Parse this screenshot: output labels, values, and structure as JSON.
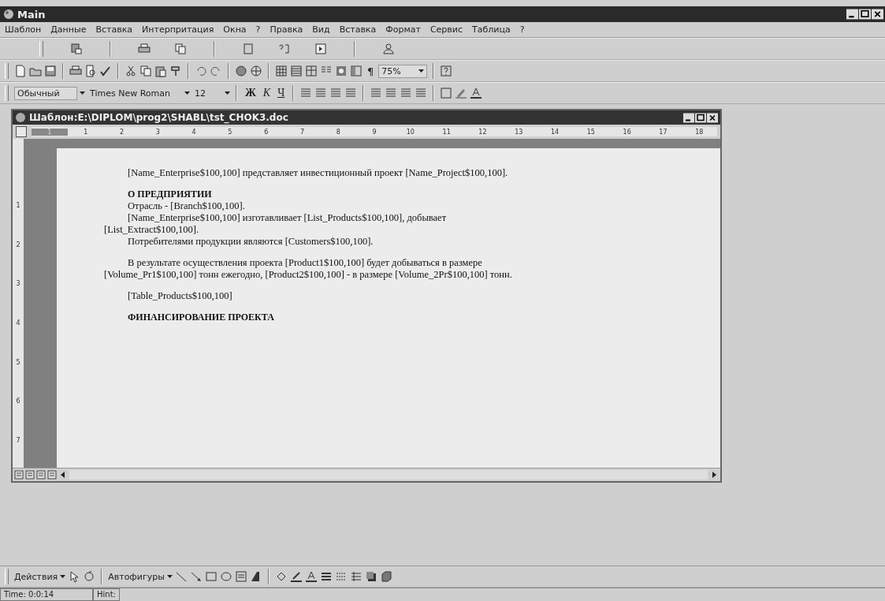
{
  "window": {
    "title": "Main"
  },
  "menu": [
    "Шаблон",
    "Данные",
    "Вставка",
    "Интерпритация",
    "Окна",
    "?",
    "Правка",
    "Вид",
    "Вставка",
    "Формат",
    "Сервис",
    "Таблица",
    "?"
  ],
  "formatting": {
    "style": "Обычный",
    "font": "Times New Roman",
    "size": "12",
    "bold": "Ж",
    "italic": "К",
    "underline": "Ч"
  },
  "standard": {
    "pilcrow": "¶",
    "zoom": "75%"
  },
  "document": {
    "title": "Шаблон:E:\\DIPLOM\\prog2\\SHABL\\tst_CHOK3.doc",
    "ruler": [
      "1",
      "1",
      "2",
      "3",
      "4",
      "5",
      "6",
      "7",
      "8",
      "9",
      "10",
      "11",
      "12",
      "13",
      "14",
      "15",
      "16",
      "17",
      "18"
    ],
    "vruler": [
      "1",
      "2",
      "3",
      "4",
      "5",
      "6",
      "7"
    ],
    "paragraphs": [
      {
        "kind": "para",
        "space_before": false,
        "lines": [
          "[Name_Enterprise$100,100] представляет инвестиционный проект [Name_Project$100,100]."
        ]
      },
      {
        "kind": "heading",
        "space_before": true,
        "lines": [
          "О ПРЕДПРИЯТИИ"
        ]
      },
      {
        "kind": "para",
        "space_before": false,
        "lines": [
          "Отрасль - [Branch$100,100]."
        ]
      },
      {
        "kind": "para",
        "space_before": false,
        "lines": [
          "[Name_Enterprise$100,100] изготавливает [List_Products$100,100], добывает",
          "[List_Extract$100,100]."
        ]
      },
      {
        "kind": "para",
        "space_before": false,
        "lines": [
          "Потребителями продукции являются [Customers$100,100]."
        ]
      },
      {
        "kind": "para",
        "space_before": true,
        "lines": [
          "В результате осуществления проекта [Product1$100,100] будет добываться в размере",
          "[Volume_Pr1$100,100] тонн ежегодно, [Product2$100,100] - в размере [Volume_2Pr$100,100] тонн."
        ]
      },
      {
        "kind": "para",
        "space_before": true,
        "lines": [
          "[Table_Products$100,100]"
        ]
      },
      {
        "kind": "heading",
        "space_before": true,
        "lines": [
          "ФИНАНСИРОВАНИЕ ПРОЕКТА"
        ]
      }
    ]
  },
  "drawing": {
    "actions": "Действия",
    "autoshapes": "Автофигуры"
  },
  "status_bar": [
    "Time: 0:0:14",
    "Hint:"
  ]
}
